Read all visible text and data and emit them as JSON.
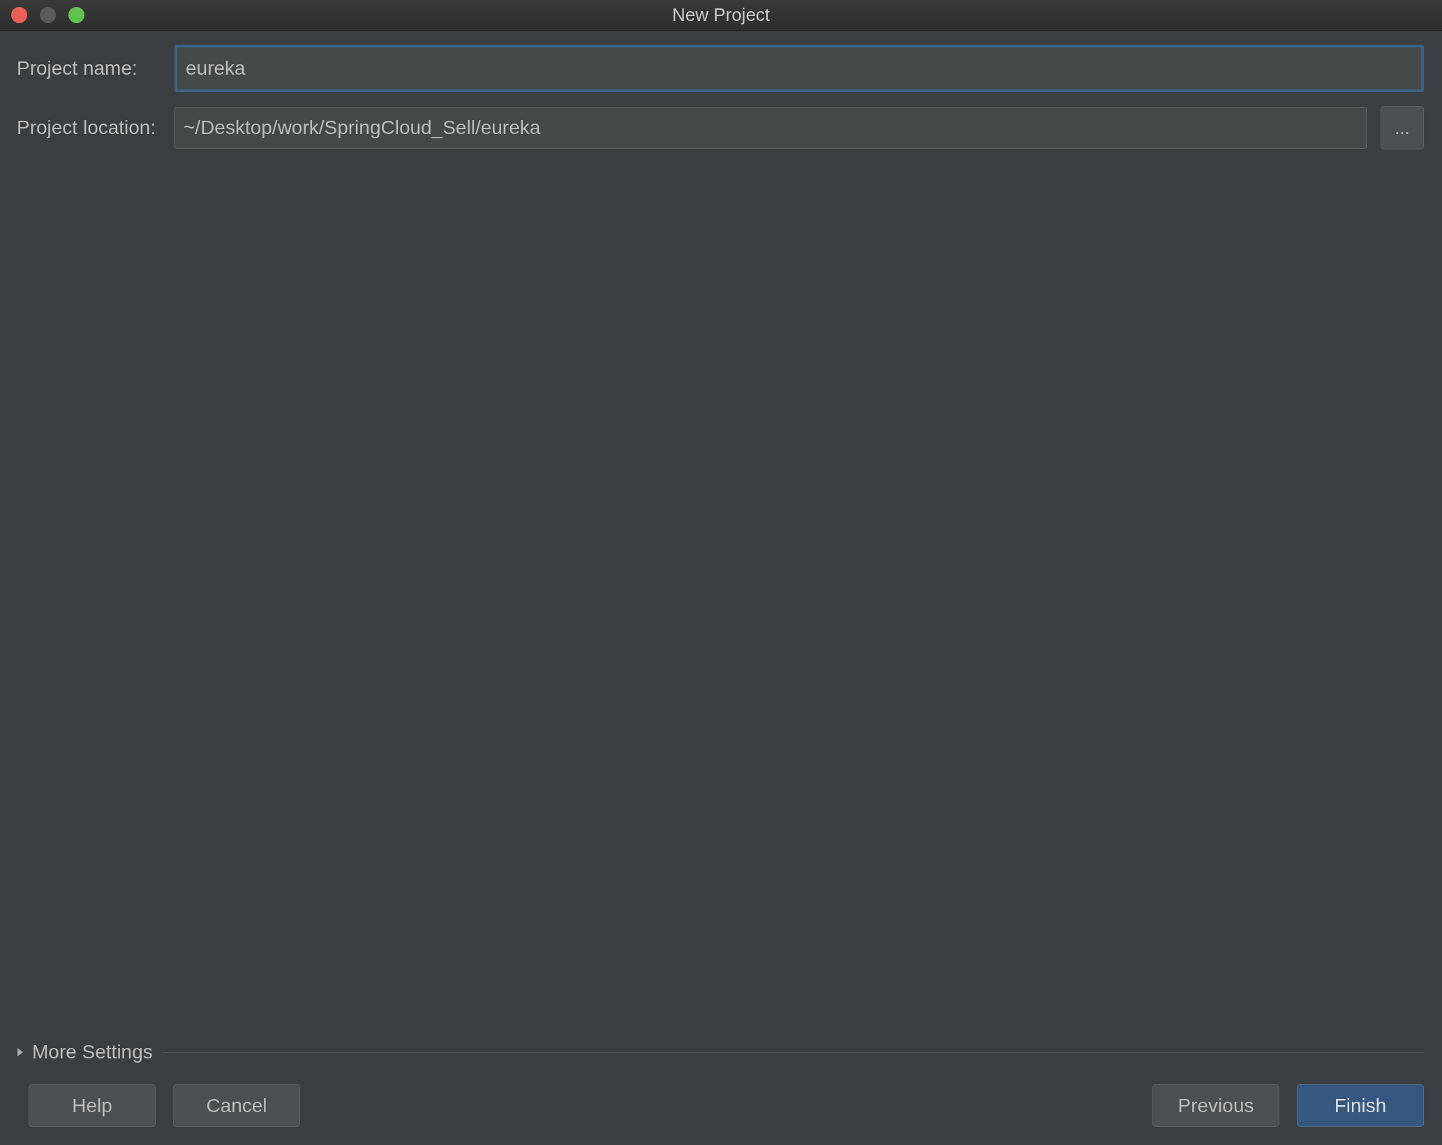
{
  "window": {
    "title": "New Project"
  },
  "fields": [
    {
      "label": "Project name:",
      "value": "eureka",
      "focused": true
    },
    {
      "label": "Project location:",
      "value": "~/Desktop/work/SpringCloud_Sell/eureka",
      "focused": false,
      "browse": "..."
    }
  ],
  "more_settings": {
    "label": "More Settings",
    "expanded": false
  },
  "buttons_left": [
    {
      "label": "Help",
      "default": false
    },
    {
      "label": "Cancel",
      "default": false
    }
  ],
  "buttons_right": [
    {
      "label": "Previous",
      "default": false
    },
    {
      "label": "Finish",
      "default": true
    }
  ]
}
